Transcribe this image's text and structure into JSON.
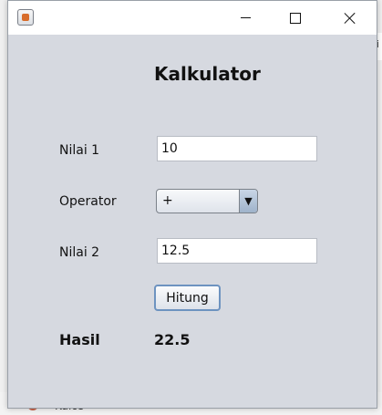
{
  "background": {
    "right_text": "fi",
    "bottom_text": "Kalos"
  },
  "window": {
    "title": "",
    "icons": {
      "app": "java-cup-icon",
      "minimize": "minimize-icon",
      "maximize": "maximize-icon",
      "close": "close-icon"
    }
  },
  "form": {
    "heading": "Kalkulator",
    "nilai1_label": "Nilai 1",
    "nilai1_value": "10",
    "operator_label": "Operator",
    "operator_value": "+",
    "operator_arrow": "▼",
    "nilai2_label": "Nilai 2",
    "nilai2_value": "12.5",
    "hitung_label": "Hitung",
    "hasil_label": "Hasil",
    "hasil_value": "22.5"
  }
}
